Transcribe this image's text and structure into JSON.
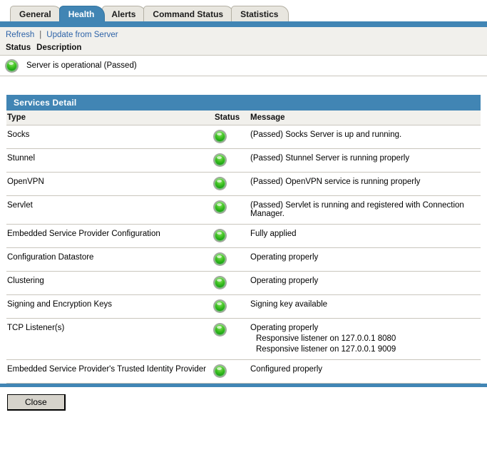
{
  "tabs": [
    {
      "label": "General",
      "active": false
    },
    {
      "label": "Health",
      "active": true
    },
    {
      "label": "Alerts",
      "active": false
    },
    {
      "label": "Command Status",
      "active": false
    },
    {
      "label": "Statistics",
      "active": false
    }
  ],
  "toolbar": {
    "refresh_label": "Refresh",
    "separator": "|",
    "update_label": "Update from Server"
  },
  "summary": {
    "col_status": "Status",
    "col_description": "Description",
    "status_icon": "green-status-led-icon",
    "description": "Server is operational (Passed)"
  },
  "panel": {
    "title": "Services Detail",
    "columns": {
      "type": "Type",
      "status": "Status",
      "message": "Message"
    },
    "rows": [
      {
        "type": "Socks",
        "status_icon": "green-status-led-icon",
        "message": "(Passed) Socks Server is up and running.",
        "submessages": []
      },
      {
        "type": "Stunnel",
        "status_icon": "green-status-led-icon",
        "message": "(Passed) Stunnel Server is running properly",
        "submessages": []
      },
      {
        "type": "OpenVPN",
        "status_icon": "green-status-led-icon",
        "message": "(Passed) OpenVPN service is running properly",
        "submessages": []
      },
      {
        "type": "Servlet",
        "status_icon": "green-status-led-icon",
        "message": "(Passed) Servlet is running and registered with Connection Manager.",
        "submessages": []
      },
      {
        "type": "Embedded Service Provider Configuration",
        "status_icon": "green-status-led-icon",
        "message": "Fully applied",
        "submessages": []
      },
      {
        "type": "Configuration Datastore",
        "status_icon": "green-status-led-icon",
        "message": "Operating properly",
        "submessages": []
      },
      {
        "type": "Clustering",
        "status_icon": "green-status-led-icon",
        "message": "Operating properly",
        "submessages": []
      },
      {
        "type": "Signing and Encryption Keys",
        "status_icon": "green-status-led-icon",
        "message": "Signing key available",
        "submessages": []
      },
      {
        "type": "TCP Listener(s)",
        "status_icon": "green-status-led-icon",
        "message": "Operating properly",
        "submessages": [
          "Responsive listener on 127.0.0.1 8080",
          "Responsive listener on 127.0.0.1 9009"
        ]
      },
      {
        "type": "Embedded Service Provider's Trusted Identity Provider",
        "status_icon": "green-status-led-icon",
        "message": "Configured properly",
        "submessages": []
      }
    ]
  },
  "footer": {
    "close_label": "Close"
  },
  "colors": {
    "accent_blue": "#4185b4",
    "tab_inactive": "#e8e6df",
    "header_grey": "#f1f0ec",
    "link_blue": "#2d63a8",
    "status_green": "#2fbd1f",
    "rule_grey": "#c9c6bd"
  }
}
